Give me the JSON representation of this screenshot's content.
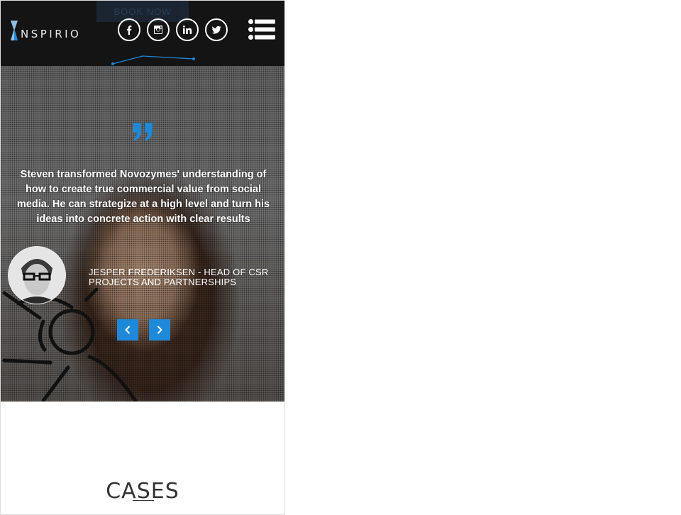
{
  "header": {
    "book_now_label": "BOOK NOW",
    "logo_text": "NSPIRIO",
    "social": [
      {
        "icon": "facebook-icon"
      },
      {
        "icon": "instagram-icon"
      },
      {
        "icon": "linkedin-icon"
      },
      {
        "icon": "twitter-icon"
      }
    ],
    "menu_icon": "hamburger-menu-icon"
  },
  "testimonial": {
    "quote_icon": "quote-icon",
    "quote": "Steven transformed Novozymes' understanding of how to create true commercial value from social media. He can strategize at a high level and turn his ideas into concrete action with clear results",
    "author": "Jesper Frederiksen - Head of CSR projects and partnerships",
    "prev_icon": "chevron-left-icon",
    "next_icon": "chevron-right-icon"
  },
  "cases": {
    "title": "CASES"
  },
  "colors": {
    "accent": "#1e88d9",
    "header_bg": "#141414"
  }
}
